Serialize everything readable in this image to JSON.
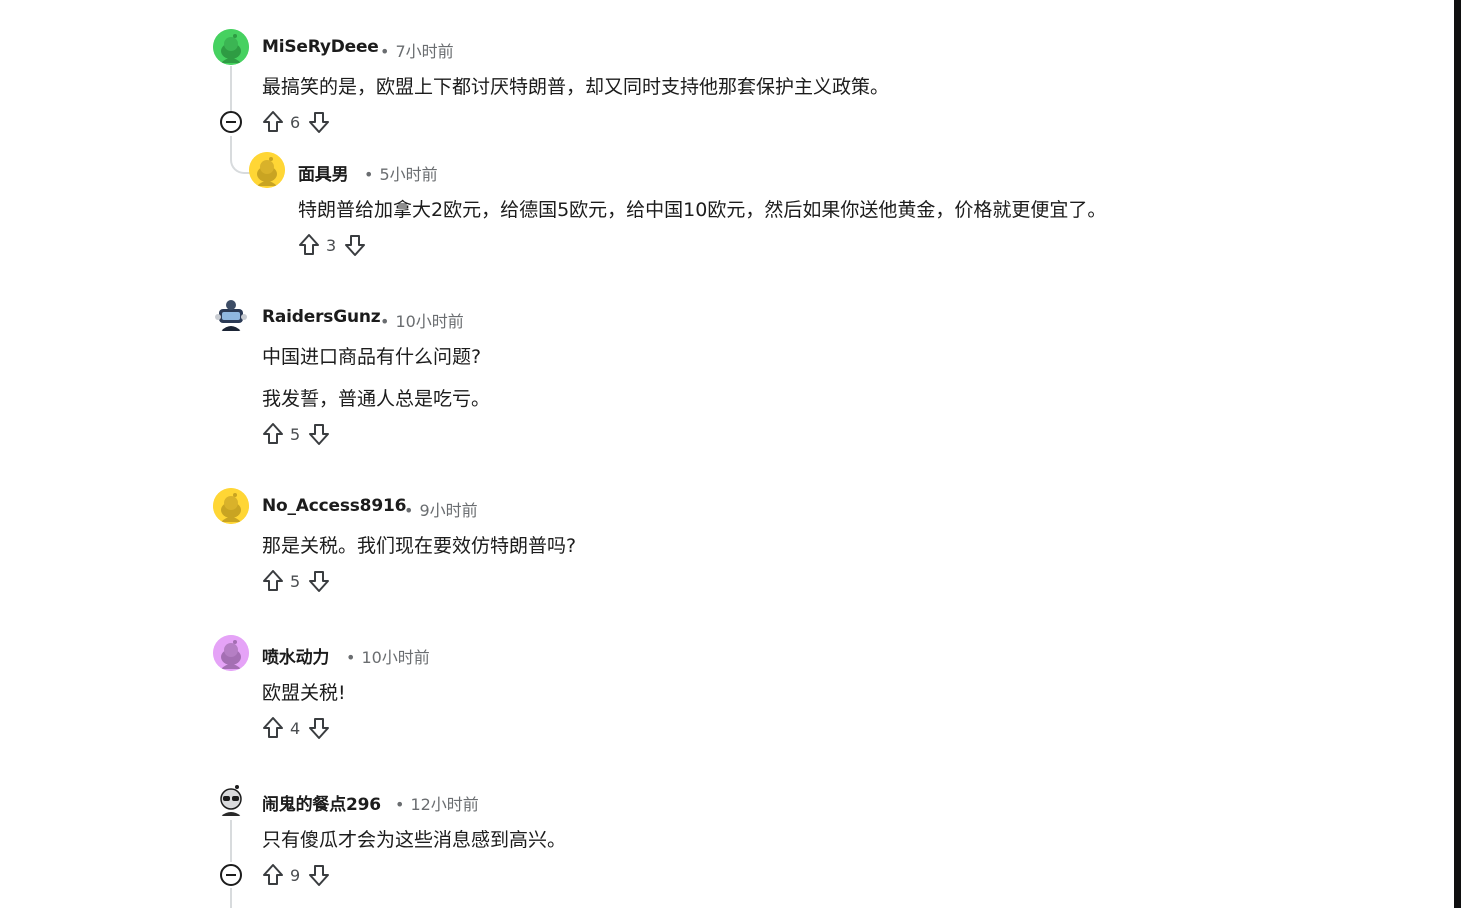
{
  "comments": [
    {
      "username": "MiSeRyDeee",
      "time": "7小时前",
      "lines": [
        "最搞笑的是，欧盟上下都讨厌特朗普，却又同时支持他那套保护主义政策。"
      ],
      "votes": "6",
      "avatar_color": "#46d160",
      "collapsible": true
    },
    {
      "username": "面具男",
      "time": "5小时前",
      "lines": [
        "特朗普给加拿大2欧元，给德国5欧元，给中国10欧元，然后如果你送他黄金，价格就更便宜了。"
      ],
      "votes": "3",
      "avatar_color": "#ffd635"
    },
    {
      "username": "RaidersGunz",
      "time": "10小时前",
      "lines": [
        "中国进口商品有什么问题?",
        "我发誓，普通人总是吃亏。"
      ],
      "votes": "5",
      "avatar_icon": "custom-snoo-avatar-icon"
    },
    {
      "username": "No_Access8916",
      "time": "9小时前",
      "lines": [
        "那是关税。我们现在要效仿特朗普吗?"
      ],
      "votes": "5",
      "avatar_color": "#ffd635"
    },
    {
      "username": "喷水动力",
      "time": "10小时前",
      "lines": [
        "欧盟关税!"
      ],
      "votes": "4",
      "avatar_color": "#e5a3f7"
    },
    {
      "username": "闹鬼的餐点296",
      "time": "12小时前",
      "lines": [
        "只有傻瓜才会为这些消息感到高兴。"
      ],
      "votes": "9",
      "avatar_icon": "sunglasses-snoo-avatar-icon",
      "collapsible": true
    }
  ],
  "meta_separator": "•",
  "icons": {
    "upvote": "upvote-arrow-icon",
    "downvote": "downvote-arrow-icon",
    "collapse": "collapse-minus-icon"
  }
}
